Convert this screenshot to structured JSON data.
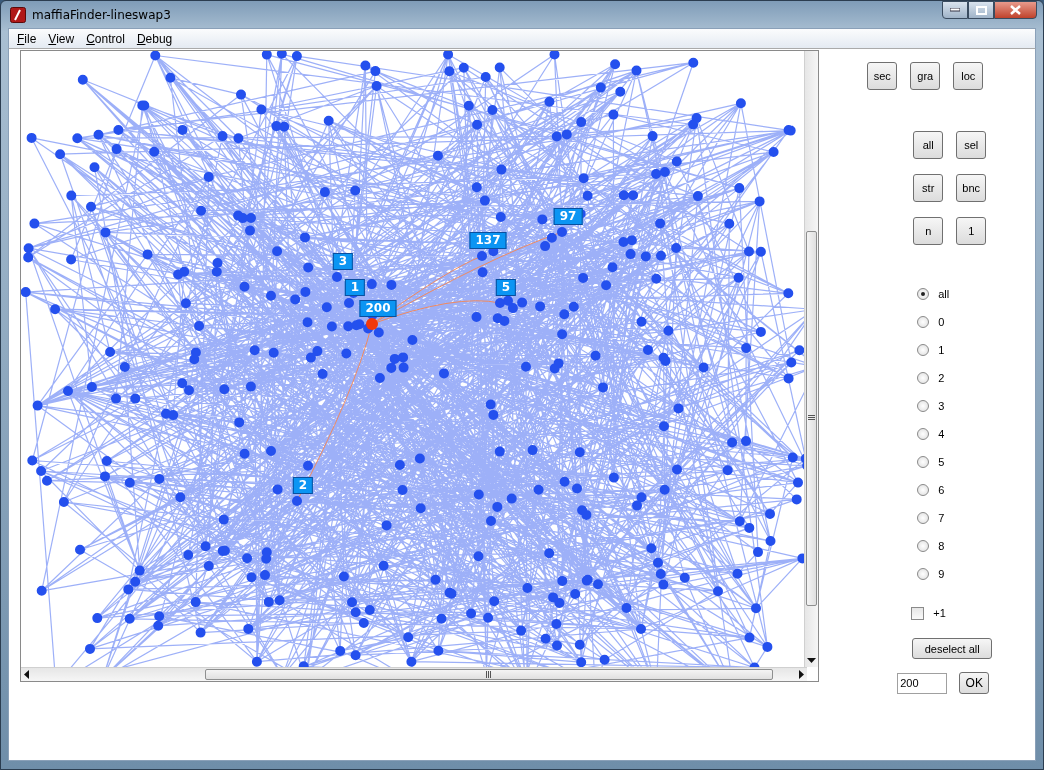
{
  "window": {
    "title": "maffiaFinder-lineswap3"
  },
  "menu": [
    {
      "label": "File"
    },
    {
      "label": "View"
    },
    {
      "label": "Control"
    },
    {
      "label": "Debug"
    }
  ],
  "graph": {
    "node_labels": [
      {
        "label": "3",
        "selected": false
      },
      {
        "label": "1",
        "selected": false
      },
      {
        "label": "200",
        "selected": true
      },
      {
        "label": "137",
        "selected": false
      },
      {
        "label": "97",
        "selected": false
      },
      {
        "label": "5",
        "selected": false
      },
      {
        "label": "2",
        "selected": false
      }
    ]
  },
  "button_rows": [
    [
      "sec",
      "gra",
      "loc"
    ],
    [
      "all",
      "sel"
    ],
    [
      "str",
      "bnc"
    ],
    [
      "n",
      "1"
    ]
  ],
  "radios": [
    {
      "label": "all",
      "selected": true
    },
    {
      "label": "0",
      "selected": false
    },
    {
      "label": "1",
      "selected": false
    },
    {
      "label": "2",
      "selected": false
    },
    {
      "label": "3",
      "selected": false
    },
    {
      "label": "4",
      "selected": false
    },
    {
      "label": "5",
      "selected": false
    },
    {
      "label": "6",
      "selected": false
    },
    {
      "label": "7",
      "selected": false
    },
    {
      "label": "8",
      "selected": false
    },
    {
      "label": "9",
      "selected": false
    }
  ],
  "checkbox": {
    "label": "+1",
    "checked": false
  },
  "deselect_button": "deselect all",
  "node_input": {
    "value": "200"
  },
  "ok_button": "OK"
}
